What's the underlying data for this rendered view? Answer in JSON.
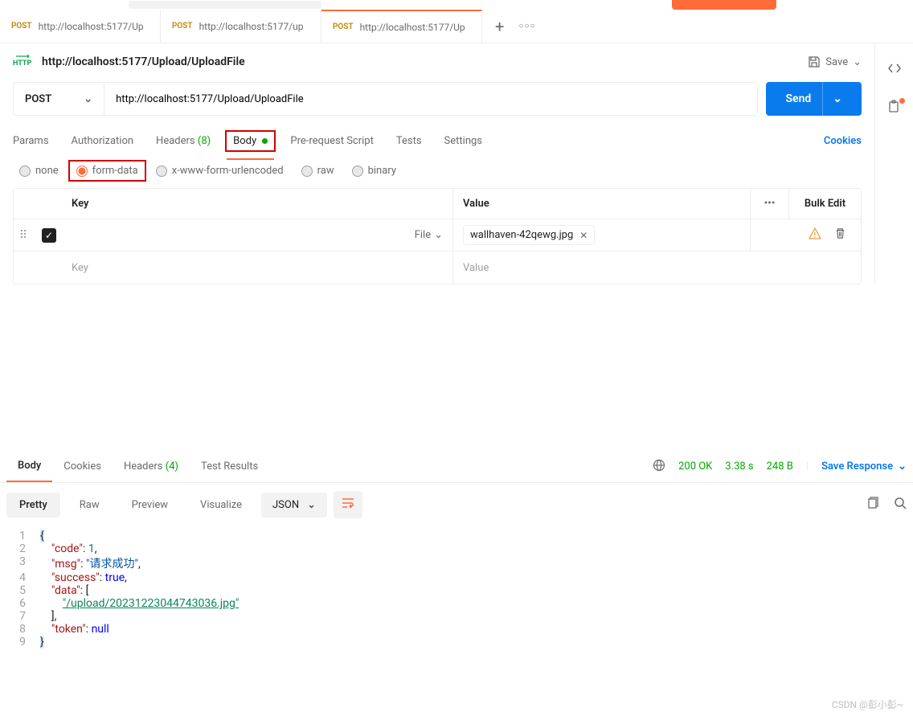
{
  "tabs": [
    {
      "method": "POST",
      "title": "http://localhost:5177/Up"
    },
    {
      "method": "POST",
      "title": "http://localhost:5177/up"
    },
    {
      "method": "POST",
      "title": "http://localhost:5177/Up"
    }
  ],
  "breadcrumb": {
    "title": "http://localhost:5177/Upload/UploadFile",
    "save_label": "Save"
  },
  "request": {
    "method": "POST",
    "url": "http://localhost:5177/Upload/UploadFile",
    "send_label": "Send"
  },
  "req_tabs": {
    "params": "Params",
    "authorization": "Authorization",
    "headers": "Headers",
    "headers_count": "(8)",
    "body": "Body",
    "pre_request": "Pre-request Script",
    "tests": "Tests",
    "settings": "Settings",
    "cookies": "Cookies"
  },
  "body_types": {
    "none": "none",
    "form_data": "form-data",
    "x_www": "x-www-form-urlencoded",
    "raw": "raw",
    "binary": "binary"
  },
  "kv": {
    "key_header": "Key",
    "value_header": "Value",
    "bulk_edit": "Bulk Edit",
    "file_label": "File",
    "file_name": "wallhaven-42qewg.jpg",
    "key_placeholder": "Key",
    "value_placeholder": "Value"
  },
  "response_tabs": {
    "body": "Body",
    "cookies": "Cookies",
    "headers": "Headers",
    "headers_count": "(4)",
    "test_results": "Test Results"
  },
  "response_meta": {
    "status": "200 OK",
    "time": "3.38 s",
    "size": "248 B",
    "save_response": "Save Response"
  },
  "view_tabs": {
    "pretty": "Pretty",
    "raw": "Raw",
    "preview": "Preview",
    "visualize": "Visualize",
    "format": "JSON"
  },
  "json_body": {
    "code_key": "\"code\"",
    "code_val": "1",
    "msg_key": "\"msg\"",
    "msg_val": "\"请求成功\"",
    "success_key": "\"success\"",
    "success_val": "true",
    "data_key": "\"data\"",
    "data_val": "\"/upload/20231223044743036.jpg\"",
    "token_key": "\"token\"",
    "token_val": "null"
  },
  "watermark": "CSDN @彭小彭~"
}
